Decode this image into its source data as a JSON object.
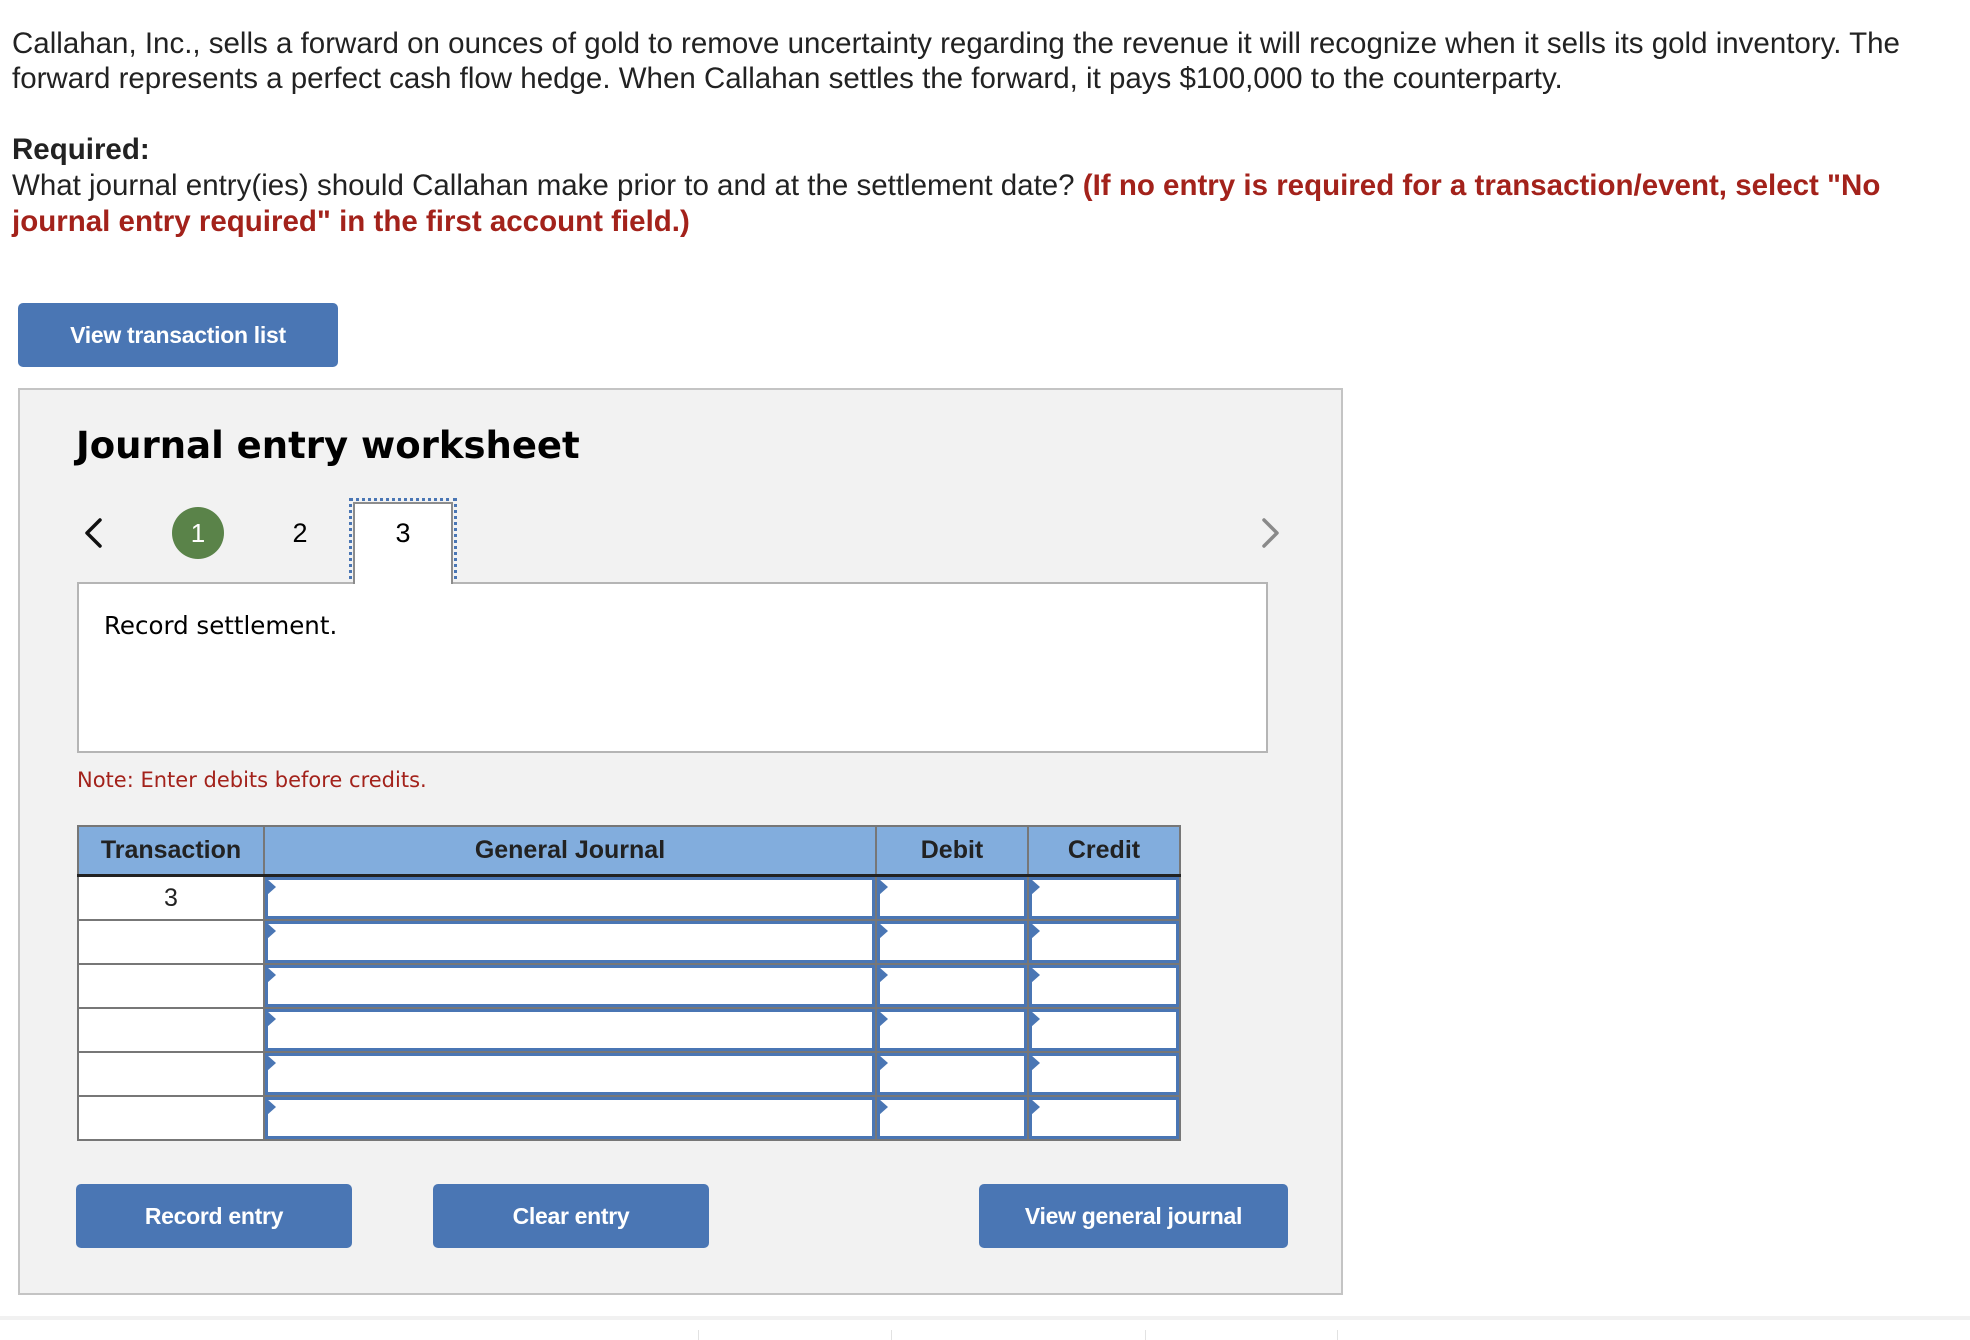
{
  "question": {
    "text": "Callahan, Inc., sells a forward on ounces of gold to remove uncertainty regarding the revenue it will recognize when it sells its gold inventory. The forward represents a perfect cash flow hedge. When Callahan settles the forward, it pays $100,000 to the counterparty.",
    "required_heading": "Required:",
    "required_text": "What journal entry(ies) should Callahan make prior to and at the settlement date?",
    "required_instruction": "(If no entry is required for a transaction/event, select \"No journal entry required\" in the first account field.)"
  },
  "toolbar": {
    "view_transaction_list_label": "View transaction list"
  },
  "worksheet": {
    "title": "Journal entry worksheet",
    "prev_icon": "chevron-left-icon",
    "next_icon": "chevron-right-icon",
    "steps": [
      {
        "label": "1",
        "state": "completed"
      },
      {
        "label": "2",
        "state": "default"
      },
      {
        "label": "3",
        "state": "active"
      }
    ],
    "description": "Record settlement.",
    "note": "Note: Enter debits before credits.",
    "colors": {
      "accent": "#4a76b4",
      "completed_step": "#5a8349",
      "header_bg": "#82addd",
      "note_red": "#a3221b"
    }
  },
  "table": {
    "headers": [
      "Transaction",
      "General Journal",
      "Debit",
      "Credit"
    ],
    "rows": [
      {
        "transaction": "3",
        "account": "",
        "debit": "",
        "credit": ""
      },
      {
        "transaction": "",
        "account": "",
        "debit": "",
        "credit": ""
      },
      {
        "transaction": "",
        "account": "",
        "debit": "",
        "credit": ""
      },
      {
        "transaction": "",
        "account": "",
        "debit": "",
        "credit": ""
      },
      {
        "transaction": "",
        "account": "",
        "debit": "",
        "credit": ""
      },
      {
        "transaction": "",
        "account": "",
        "debit": "",
        "credit": ""
      }
    ]
  },
  "actions": {
    "record_entry_label": "Record entry",
    "clear_entry_label": "Clear entry",
    "view_general_journal_label": "View general journal"
  }
}
